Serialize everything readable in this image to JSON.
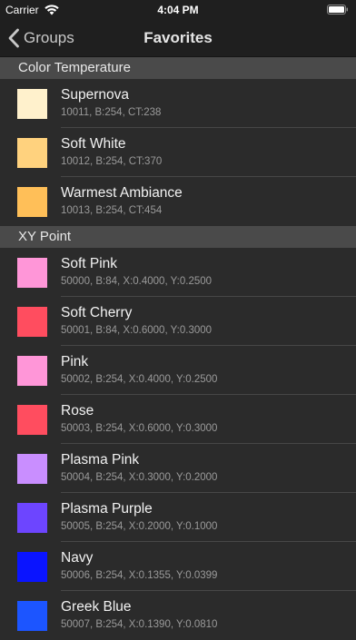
{
  "status_bar": {
    "carrier": "Carrier",
    "time": "4:04 PM"
  },
  "nav": {
    "back_label": "Groups",
    "title": "Favorites"
  },
  "sections": [
    {
      "title": "Color Temperature",
      "items": [
        {
          "name": "Supernova",
          "details": "10011, B:254, CT:238",
          "color": "#fff1cc"
        },
        {
          "name": "Soft White",
          "details": "10012, B:254, CT:370",
          "color": "#ffd27e"
        },
        {
          "name": "Warmest Ambiance",
          "details": "10013, B:254, CT:454",
          "color": "#ffbf58"
        }
      ]
    },
    {
      "title": "XY Point",
      "items": [
        {
          "name": "Soft Pink",
          "details": "50000, B:84, X:0.4000, Y:0.2500",
          "color": "#ff96d8"
        },
        {
          "name": "Soft Cherry",
          "details": "50001, B:84, X:0.6000, Y:0.3000",
          "color": "#ff4d5f"
        },
        {
          "name": "Pink",
          "details": "50002, B:254, X:0.4000, Y:0.2500",
          "color": "#ff96d8"
        },
        {
          "name": "Rose",
          "details": "50003, B:254, X:0.6000, Y:0.3000",
          "color": "#ff4d5f"
        },
        {
          "name": "Plasma Pink",
          "details": "50004, B:254, X:0.3000, Y:0.2000",
          "color": "#c98eff"
        },
        {
          "name": "Plasma Purple",
          "details": "50005, B:254, X:0.2000, Y:0.1000",
          "color": "#6d45ff"
        },
        {
          "name": "Navy",
          "details": "50006, B:254, X:0.1355, Y:0.0399",
          "color": "#0a14ff"
        },
        {
          "name": "Greek Blue",
          "details": "50007, B:254, X:0.1390, Y:0.0810",
          "color": "#1c55ff"
        }
      ]
    }
  ]
}
